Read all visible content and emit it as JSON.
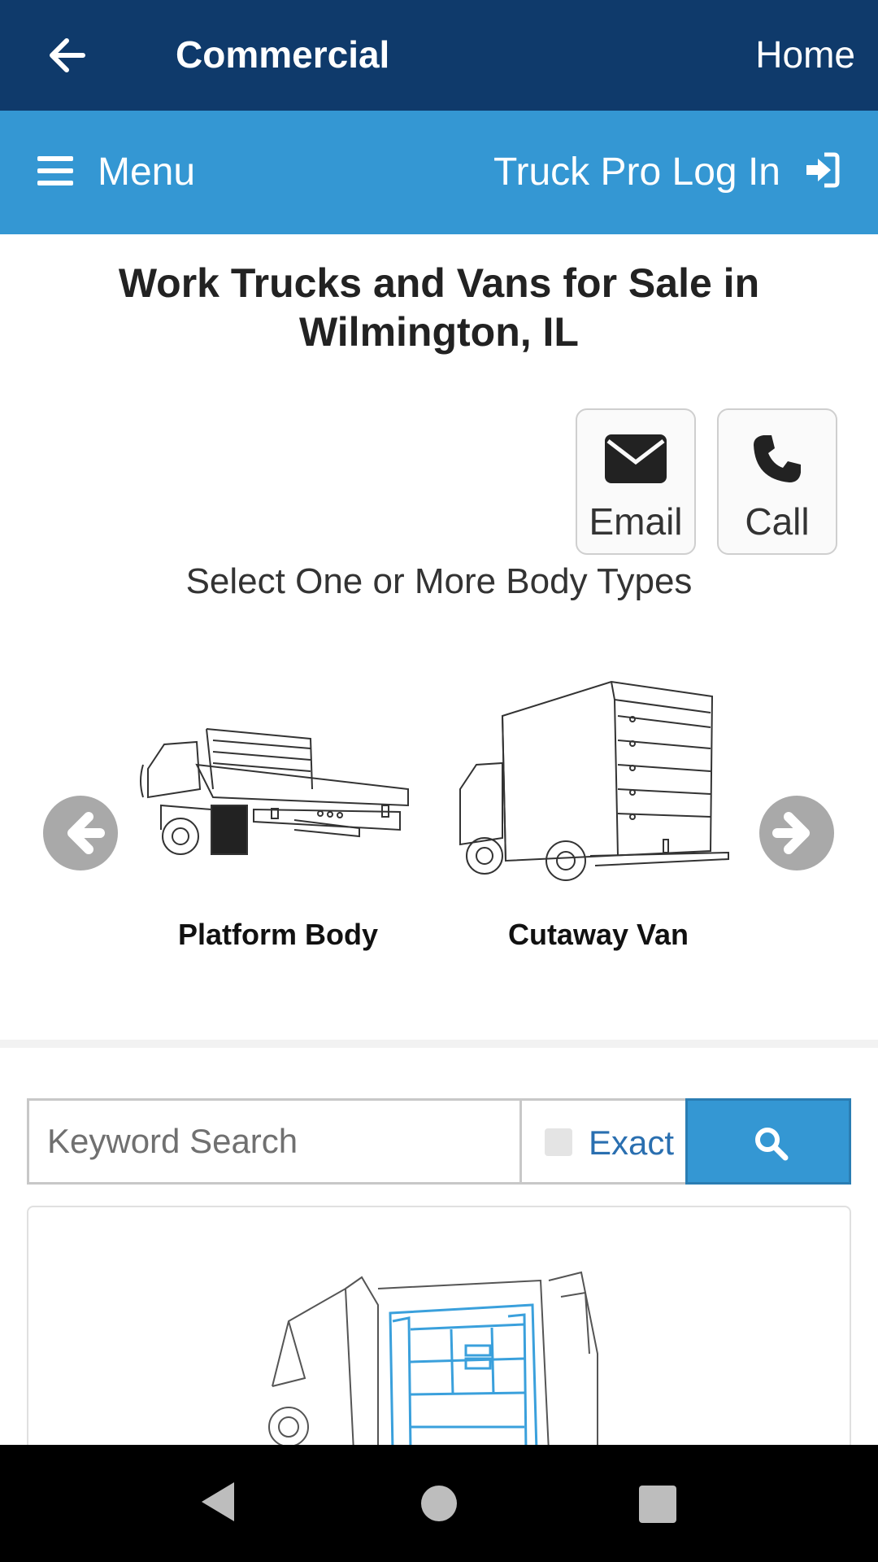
{
  "topbar": {
    "back_icon": "arrow-left-icon",
    "title": "Commercial",
    "home_label": "Home"
  },
  "subbar": {
    "menu_icon": "hamburger-icon",
    "menu_label": "Menu",
    "login_label": "Truck Pro Log In",
    "login_icon": "sign-in-icon"
  },
  "page": {
    "heading": "Work Trucks and Vans for Sale in Wilmington, IL"
  },
  "contact": {
    "email": {
      "label": "Email",
      "icon": "envelope-icon"
    },
    "call": {
      "label": "Call",
      "icon": "phone-icon"
    }
  },
  "body_types": {
    "prompt": "Select One or More Body Types",
    "prev_icon": "circle-arrow-left-icon",
    "next_icon": "circle-arrow-right-icon",
    "items": [
      {
        "label": "Platform Body"
      },
      {
        "label": "Cutaway Van"
      }
    ]
  },
  "search": {
    "placeholder": "Keyword Search",
    "exact_label": "Exact",
    "exact_checked": false,
    "button_icon": "search-icon"
  },
  "colors": {
    "topbar": "#0f3a6b",
    "subbar": "#3497d3",
    "accent_link": "#2a6fb0",
    "van_shelving": "#3aa0dc"
  }
}
